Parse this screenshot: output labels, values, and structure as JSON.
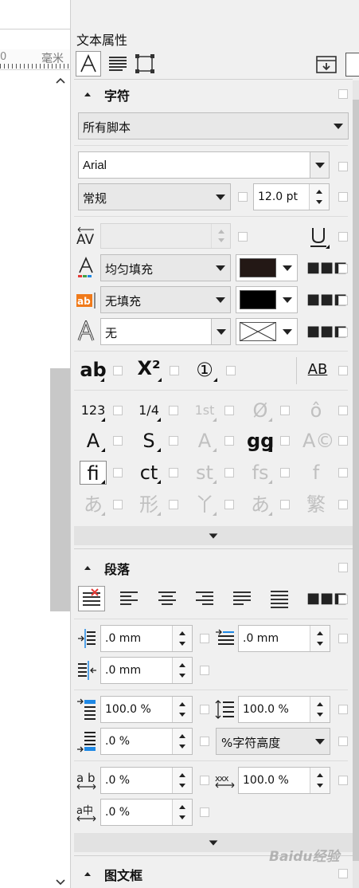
{
  "ruler": {
    "number": "0",
    "unit": "毫米"
  },
  "panel": {
    "title": "文本属性"
  },
  "character": {
    "heading": "字符",
    "script": "所有脚本",
    "font": "Arial",
    "style": "常规",
    "size": "12.0 pt",
    "fill_type": "均匀填充",
    "fill_color": "#231815",
    "bg_fill_type": "无填充",
    "bg_color": "#000000",
    "outline": "无",
    "glyph_row1": [
      "ab",
      "X²",
      "①",
      "AB"
    ],
    "glyph_grid": [
      [
        "123",
        "1/4",
        "1st",
        "Ø",
        "ô"
      ],
      [
        "A",
        "S",
        "A",
        "gg",
        "A©"
      ],
      [
        "fi",
        "ct",
        "st",
        "fs",
        "f"
      ],
      [
        "あ",
        "形",
        "丫",
        "あ",
        "繁"
      ]
    ]
  },
  "paragraph": {
    "heading": "段落",
    "left_indent": ".0 mm",
    "first_indent": ".0 mm",
    "right_indent": ".0 mm",
    "space_before": "100.0 %",
    "line_spacing": "100.0 %",
    "space_after": ".0 %",
    "spacing_unit": "%字符高度",
    "char_spacing": ".0 %",
    "word_spacing": "100.0 %",
    "lang_spacing": ".0 %"
  },
  "frame": {
    "heading": "图文框"
  },
  "watermark": "Baidu经验"
}
